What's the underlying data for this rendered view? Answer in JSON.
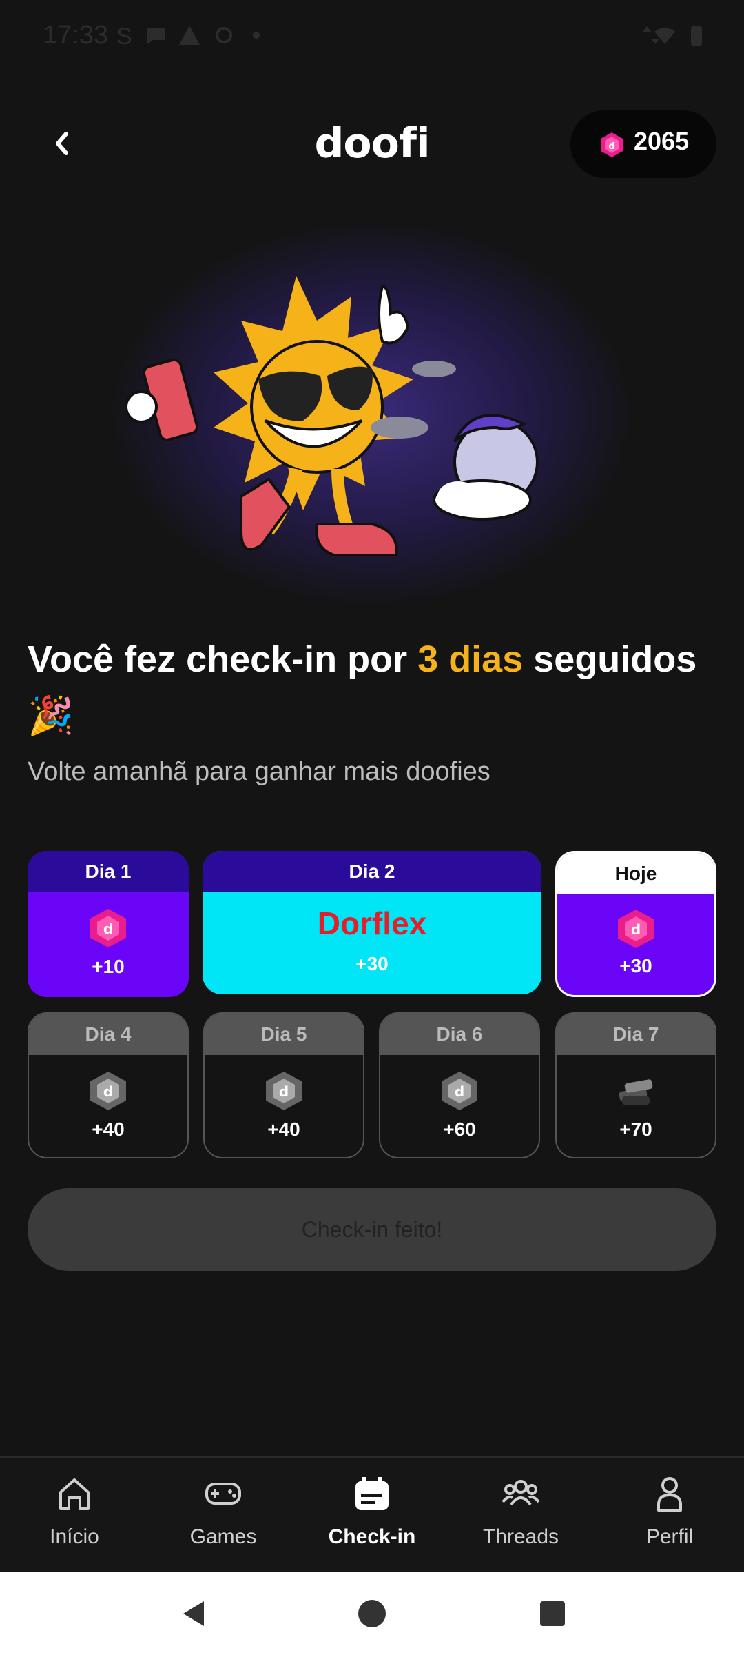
{
  "status_bar": {
    "time": "17:33",
    "icons": [
      "s-icon",
      "message-icon",
      "warning-icon",
      "at-icon",
      "dot-icon",
      "data-arrows-icon",
      "wifi-icon",
      "battery-icon"
    ]
  },
  "header": {
    "logo": "doofi",
    "coins": "2065",
    "coin_icon": "doofi-coin-icon",
    "back_icon": "chevron-left-icon"
  },
  "headline": {
    "part1": "Você fez check-in por ",
    "highlight": "3 dias",
    "part2": " seguidos",
    "emoji": "🎉"
  },
  "subtitle": "Volte amanhã para ganhar mais doofies",
  "days_row1": [
    {
      "label": "Dia 1",
      "reward": "+10"
    },
    {
      "label": "Dia 2",
      "brand": "Dorflex",
      "reward": "+30"
    },
    {
      "label": "Hoje",
      "reward": "+30"
    }
  ],
  "days_row2": [
    {
      "label": "Dia 4",
      "reward": "+40"
    },
    {
      "label": "Dia 5",
      "reward": "+40"
    },
    {
      "label": "Dia 6",
      "reward": "+60"
    },
    {
      "label": "Dia 7",
      "reward": "+70"
    }
  ],
  "checkin_button": "Check-in feito!",
  "nav": [
    {
      "label": "Início",
      "icon": "home-icon"
    },
    {
      "label": "Games",
      "icon": "gamepad-icon"
    },
    {
      "label": "Check-in",
      "icon": "calendar-icon",
      "active": true
    },
    {
      "label": "Threads",
      "icon": "people-icon"
    },
    {
      "label": "Perfil",
      "icon": "user-icon"
    }
  ],
  "colors": {
    "accent": "#f6b219",
    "purple": "#6b05f8",
    "cyan": "#00e6f7",
    "dark_purple": "#2b0c9a",
    "gem_pink": "#e91d8c"
  }
}
